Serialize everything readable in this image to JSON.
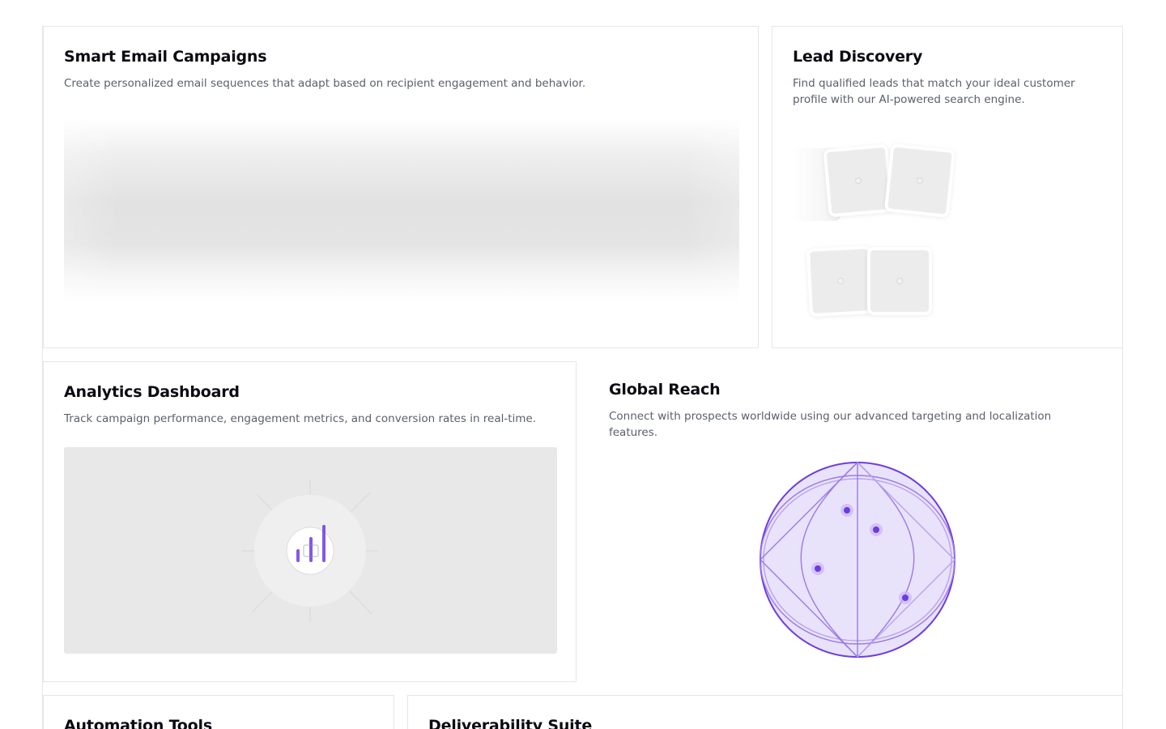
{
  "cards": {
    "email": {
      "title": "Smart Email Campaigns",
      "description": "Create personalized email sequences that adapt based on recipient engagement and behavior."
    },
    "lead": {
      "title": "Lead Discovery",
      "description": "Find qualified leads that match your ideal customer profile with our AI-powered search engine."
    },
    "analytics": {
      "title": "Analytics Dashboard",
      "description": "Track campaign performance, engagement metrics, and conversion rates in real-time."
    },
    "global": {
      "title": "Global Reach",
      "description": "Connect with prospects worldwide using our advanced targeting and localization features."
    },
    "automation": {
      "title": "Automation Tools"
    },
    "deliverability": {
      "title": "Deliverability Suite"
    }
  },
  "icons": {
    "analytics": "bar-chart-icon",
    "globe": "globe-icon"
  },
  "colors": {
    "accent": "#6d3ce0",
    "accent_light": "#e9e2fb",
    "accent_mid": "#b9a2ef"
  }
}
